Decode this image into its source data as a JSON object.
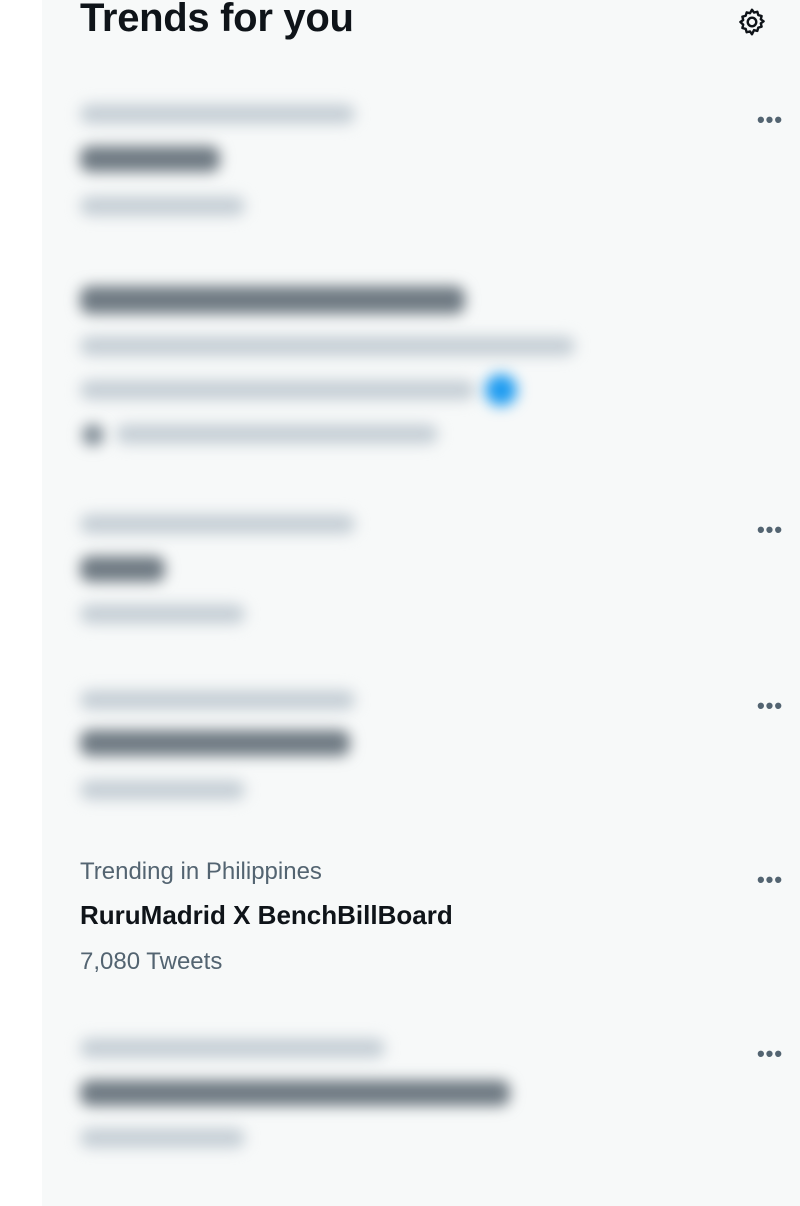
{
  "header": {
    "title": "Trends for you",
    "settings_icon": "gear-icon"
  },
  "more_icon": "more-horizontal-icon",
  "more_glyph": "•••",
  "visible_trend": {
    "meta": "Trending in Philippines",
    "title": "RuruMadrid X BenchBillBoard",
    "count": "7,080 Tweets"
  },
  "colors": {
    "panel_background": "#f7f9f9",
    "primary_text": "#0f1419",
    "secondary_text": "#536471",
    "accent": "#1d9bf0"
  }
}
